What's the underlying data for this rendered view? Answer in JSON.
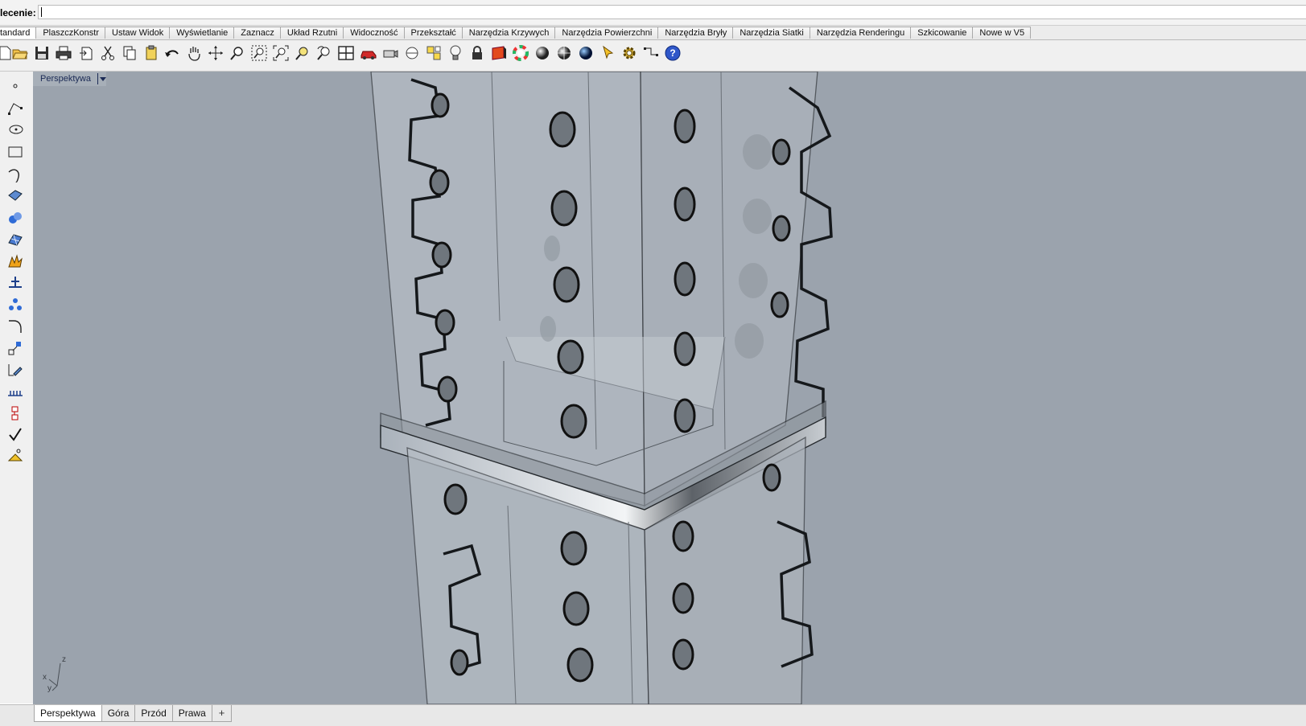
{
  "command": {
    "label": "lecenie:",
    "value": ""
  },
  "tabs": [
    {
      "label": "tandard",
      "active": true
    },
    {
      "label": "PlaszczKonstr"
    },
    {
      "label": "Ustaw Widok"
    },
    {
      "label": "Wyświetlanie"
    },
    {
      "label": "Zaznacz"
    },
    {
      "label": "Układ Rzutni"
    },
    {
      "label": "Widoczność"
    },
    {
      "label": "Przekształć"
    },
    {
      "label": "Narzędzia Krzywych"
    },
    {
      "label": "Narzędzia Powierzchni"
    },
    {
      "label": "Narzędzia Bryły"
    },
    {
      "label": "Narzędzia Siatki"
    },
    {
      "label": "Narzędzia Renderingu"
    },
    {
      "label": "Szkicowanie"
    },
    {
      "label": "Nowe w V5"
    }
  ],
  "toolbar_icons": [
    "new-document-icon",
    "open-folder-icon",
    "save-icon",
    "print-icon",
    "import-icon",
    "cut-icon",
    "copy-icon",
    "paste-icon",
    "undo-icon",
    "pan-hand-icon",
    "rotate-view-icon",
    "zoom-icon",
    "zoom-window-icon",
    "zoom-extents-icon",
    "zoom-selected-icon",
    "undo-view-icon",
    "four-viewports-icon",
    "car-render-icon",
    "camera-target-icon",
    "grid-snap-icon",
    "layer-properties-icon",
    "lightbulb-icon",
    "lock-icon",
    "material-icon",
    "color-wheel-icon",
    "shaded-sphere-icon",
    "rendered-sphere-icon",
    "render-sphere-icon",
    "selection-filter-icon",
    "options-gear-icon",
    "dimension-icon",
    "help-icon"
  ],
  "left_tool_icons": [
    "point-icon",
    "polyline-icon",
    "circle-icon",
    "rectangle-icon",
    "curve-icon",
    "surface-icon",
    "solid-spheres-icon",
    "mesh-icon",
    "explode-icon",
    "analyze-icon",
    "array-icon",
    "fillet-curve-icon",
    "transform-scale-icon",
    "edit-points-icon",
    "dimension-tool-icon",
    "grip-tool-icon",
    "check-icon",
    "render-tool-icon"
  ],
  "viewport": {
    "title": "Perspektywa",
    "axis": {
      "x": "x",
      "y": "y",
      "z": "z"
    }
  },
  "viewport_tabs": [
    {
      "label": "Perspektywa",
      "active": true
    },
    {
      "label": "Góra"
    },
    {
      "label": "Przód"
    },
    {
      "label": "Prawa"
    }
  ],
  "add_tab_symbol": "+",
  "colors": {
    "viewport_bg": "#9ba3ad",
    "active_tab": "#ffffff"
  }
}
